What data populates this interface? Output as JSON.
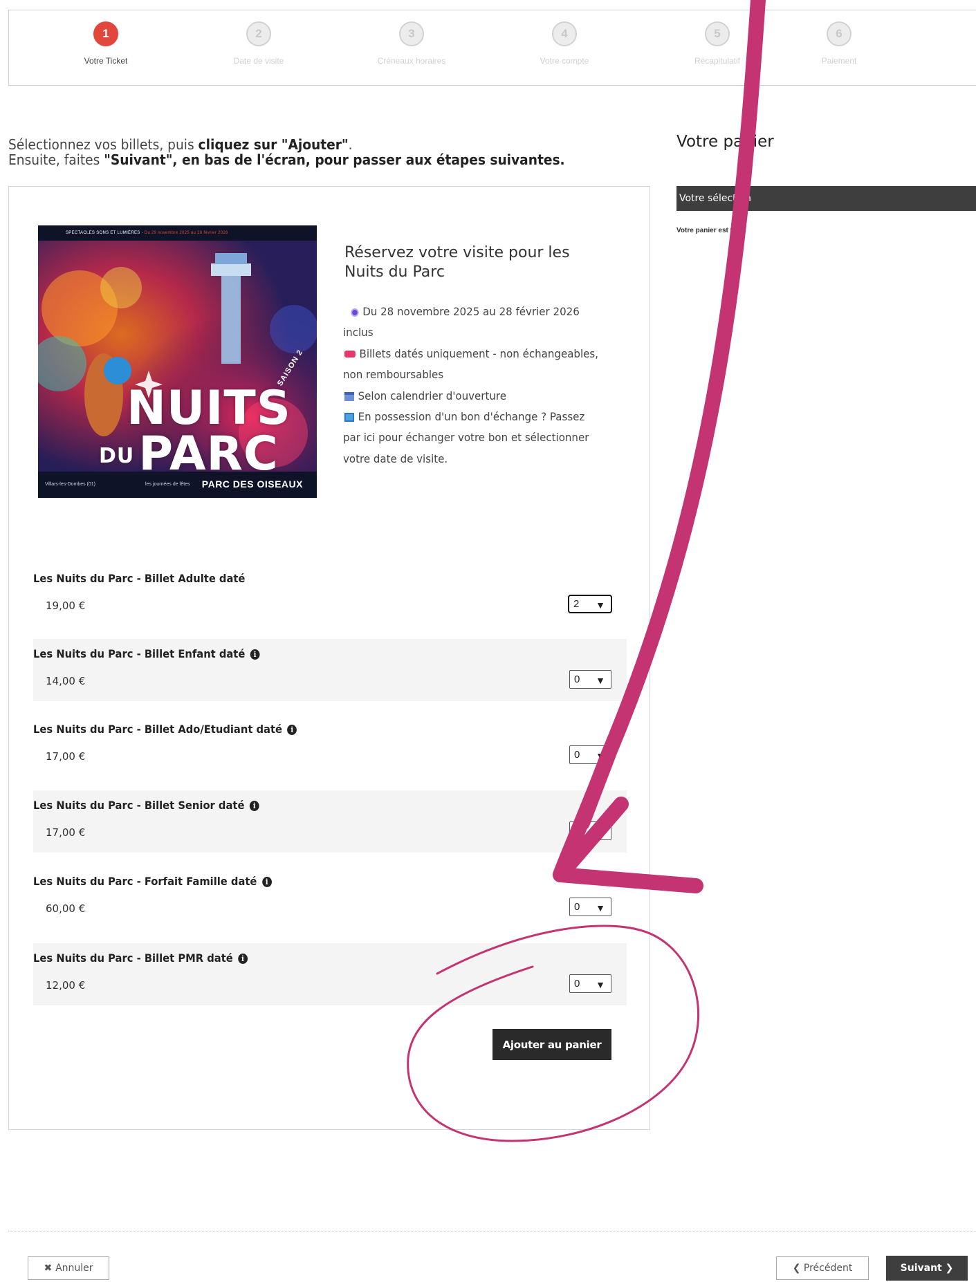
{
  "steps": [
    {
      "number": "1",
      "label": "Votre Ticket"
    },
    {
      "number": "2",
      "label": "Date de visite"
    },
    {
      "number": "3",
      "label": "Créneaux horaires"
    },
    {
      "number": "4",
      "label": "Votre compte"
    },
    {
      "number": "5",
      "label": "Récapitulatif"
    },
    {
      "number": "6",
      "label": "Paiement"
    }
  ],
  "instructions": {
    "line1_prefix": "Sélectionnez vos billets, puis ",
    "line1_bold": "cliquez sur \"Ajouter\"",
    "line1_suffix": ".",
    "line2_prefix": "Ensuite, faites ",
    "line2_bold": "\"Suivant\", en bas de l'écran, pour passer aux étapes suivantes."
  },
  "poster": {
    "top_text_white": "SPECTACLES SONS ET LUMIÈRES · ",
    "top_text_red": "Du 29 novembre 2025 au 28 février 2026",
    "saison": "SAISON 2",
    "title_line1": "NUITS",
    "title_du": "DU",
    "title_line2": "PARC",
    "bottom_left": "Villars-les-Dombes (01)",
    "bottom_mid": "les journées de fêtes",
    "bottom_logo": "PARC DES OISEAUX"
  },
  "event": {
    "title": "Réservez votre visite pour les Nuits du Parc",
    "dates": "Du 28 novembre 2025 au 28 février 2026 inclus",
    "tickets_note": "Billets datés uniquement - non échangeables, non remboursables",
    "calendar_note": "Selon calendrier d'ouverture",
    "exchange_note": "En possession d'un bon d'échange ? Passez par ici pour échanger votre bon et sélectionner votre date de visite."
  },
  "tickets": [
    {
      "name": "Les Nuits du Parc - Billet Adulte daté",
      "price": "19,00 €",
      "qty": "2",
      "info": false
    },
    {
      "name": "Les Nuits du Parc - Billet Enfant daté",
      "price": "14,00 €",
      "qty": "0",
      "info": true
    },
    {
      "name": "Les Nuits du Parc - Billet Ado/Etudiant daté",
      "price": "17,00 €",
      "qty": "0",
      "info": true
    },
    {
      "name": "Les Nuits du Parc - Billet Senior daté",
      "price": "17,00 €",
      "qty": "0",
      "info": true
    },
    {
      "name": "Les Nuits du Parc - Forfait Famille daté",
      "price": "60,00 €",
      "qty": "0",
      "info": true
    },
    {
      "name": "Les Nuits du Parc - Billet PMR daté",
      "price": "12,00 €",
      "qty": "0",
      "info": true
    }
  ],
  "add_button_label": "Ajouter au panier",
  "cart": {
    "title": "Votre panier",
    "section_label": "Votre sélection",
    "empty_text": "Votre panier est vide"
  },
  "footer": {
    "cancel_label": "Annuler",
    "previous_label": "Précédent",
    "next_label": "Suivant"
  },
  "colors": {
    "active_step": "#e2473d",
    "annotation": "#c43472",
    "dark_button": "#2a2a2a"
  }
}
